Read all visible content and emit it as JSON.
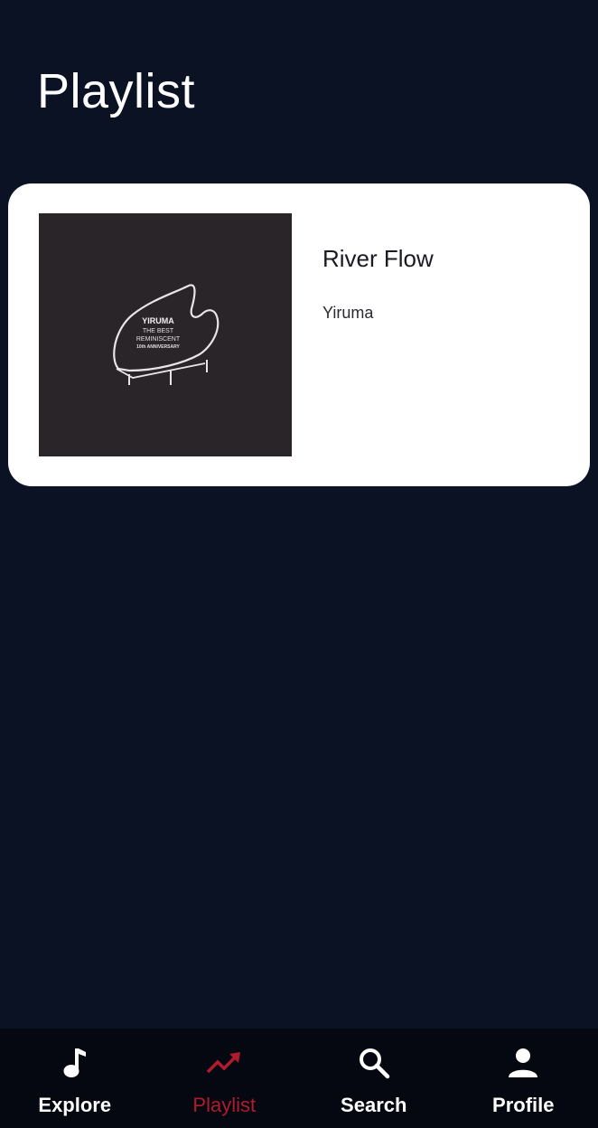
{
  "header": {
    "title": "Playlist"
  },
  "playlist": {
    "items": [
      {
        "title": "River Flow",
        "artist": "Yiruma",
        "album_art": {
          "line1": "YIRUMA",
          "line2": "THE BEST",
          "line3": "REMINISCENT",
          "line4": "10th ANNIVERSARY"
        }
      }
    ]
  },
  "bottom_nav": {
    "items": [
      {
        "label": "Explore",
        "icon": "music-note-icon",
        "active": false
      },
      {
        "label": "Playlist",
        "icon": "trending-icon",
        "active": true
      },
      {
        "label": "Search",
        "icon": "search-icon",
        "active": false
      },
      {
        "label": "Profile",
        "icon": "person-icon",
        "active": false
      }
    ]
  },
  "colors": {
    "background": "#0b1224",
    "nav_background": "#050811",
    "card": "#ffffff",
    "accent_active": "#b01c2e"
  }
}
